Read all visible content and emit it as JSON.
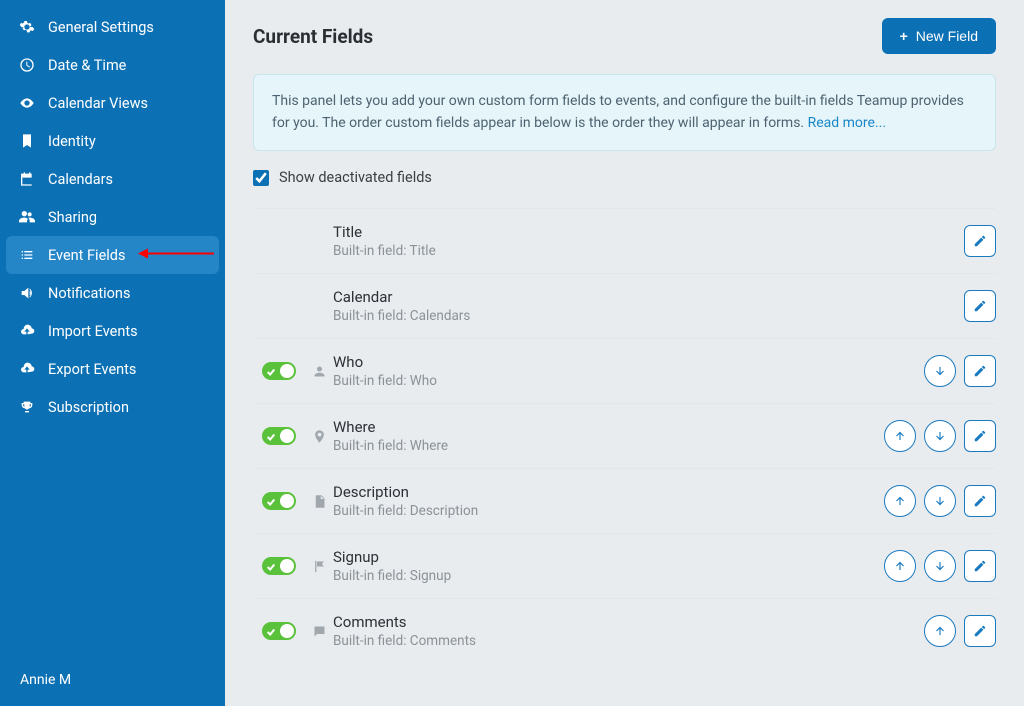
{
  "sidebar": {
    "items": [
      {
        "label": "General Settings",
        "icon": "gear"
      },
      {
        "label": "Date & Time",
        "icon": "clock"
      },
      {
        "label": "Calendar Views",
        "icon": "eye"
      },
      {
        "label": "Identity",
        "icon": "bookmark"
      },
      {
        "label": "Calendars",
        "icon": "calendar"
      },
      {
        "label": "Sharing",
        "icon": "users"
      },
      {
        "label": "Event Fields",
        "icon": "list",
        "active": true
      },
      {
        "label": "Notifications",
        "icon": "volume"
      },
      {
        "label": "Import Events",
        "icon": "cloud-up"
      },
      {
        "label": "Export Events",
        "icon": "cloud-up"
      },
      {
        "label": "Subscription",
        "icon": "trophy"
      }
    ],
    "footer_user": "Annie M"
  },
  "header": {
    "title": "Current Fields",
    "button_label": "New Field"
  },
  "info_panel": {
    "text": "This panel lets you add your own custom form fields to events, and configure the built-in fields Teamup provides for you. The order custom fields appear in below is the order they will appear in forms. ",
    "link_text": "Read more..."
  },
  "show_deactivated": {
    "label": "Show deactivated fields",
    "checked": true
  },
  "fields": [
    {
      "name": "Title",
      "sub": "Built-in field: Title",
      "toggle": false,
      "up": false,
      "down": false,
      "edit": true,
      "icon": ""
    },
    {
      "name": "Calendar",
      "sub": "Built-in field: Calendars",
      "toggle": false,
      "up": false,
      "down": false,
      "edit": true,
      "icon": ""
    },
    {
      "name": "Who",
      "sub": "Built-in field: Who",
      "toggle": true,
      "up": false,
      "down": true,
      "edit": true,
      "icon": "person"
    },
    {
      "name": "Where",
      "sub": "Built-in field: Where",
      "toggle": true,
      "up": true,
      "down": true,
      "edit": true,
      "icon": "pin"
    },
    {
      "name": "Description",
      "sub": "Built-in field: Description",
      "toggle": true,
      "up": true,
      "down": true,
      "edit": true,
      "icon": "doc"
    },
    {
      "name": "Signup",
      "sub": "Built-in field: Signup",
      "toggle": true,
      "up": true,
      "down": true,
      "edit": true,
      "icon": "flag"
    },
    {
      "name": "Comments",
      "sub": "Built-in field: Comments",
      "toggle": true,
      "up": true,
      "down": false,
      "edit": true,
      "icon": "chat"
    }
  ]
}
